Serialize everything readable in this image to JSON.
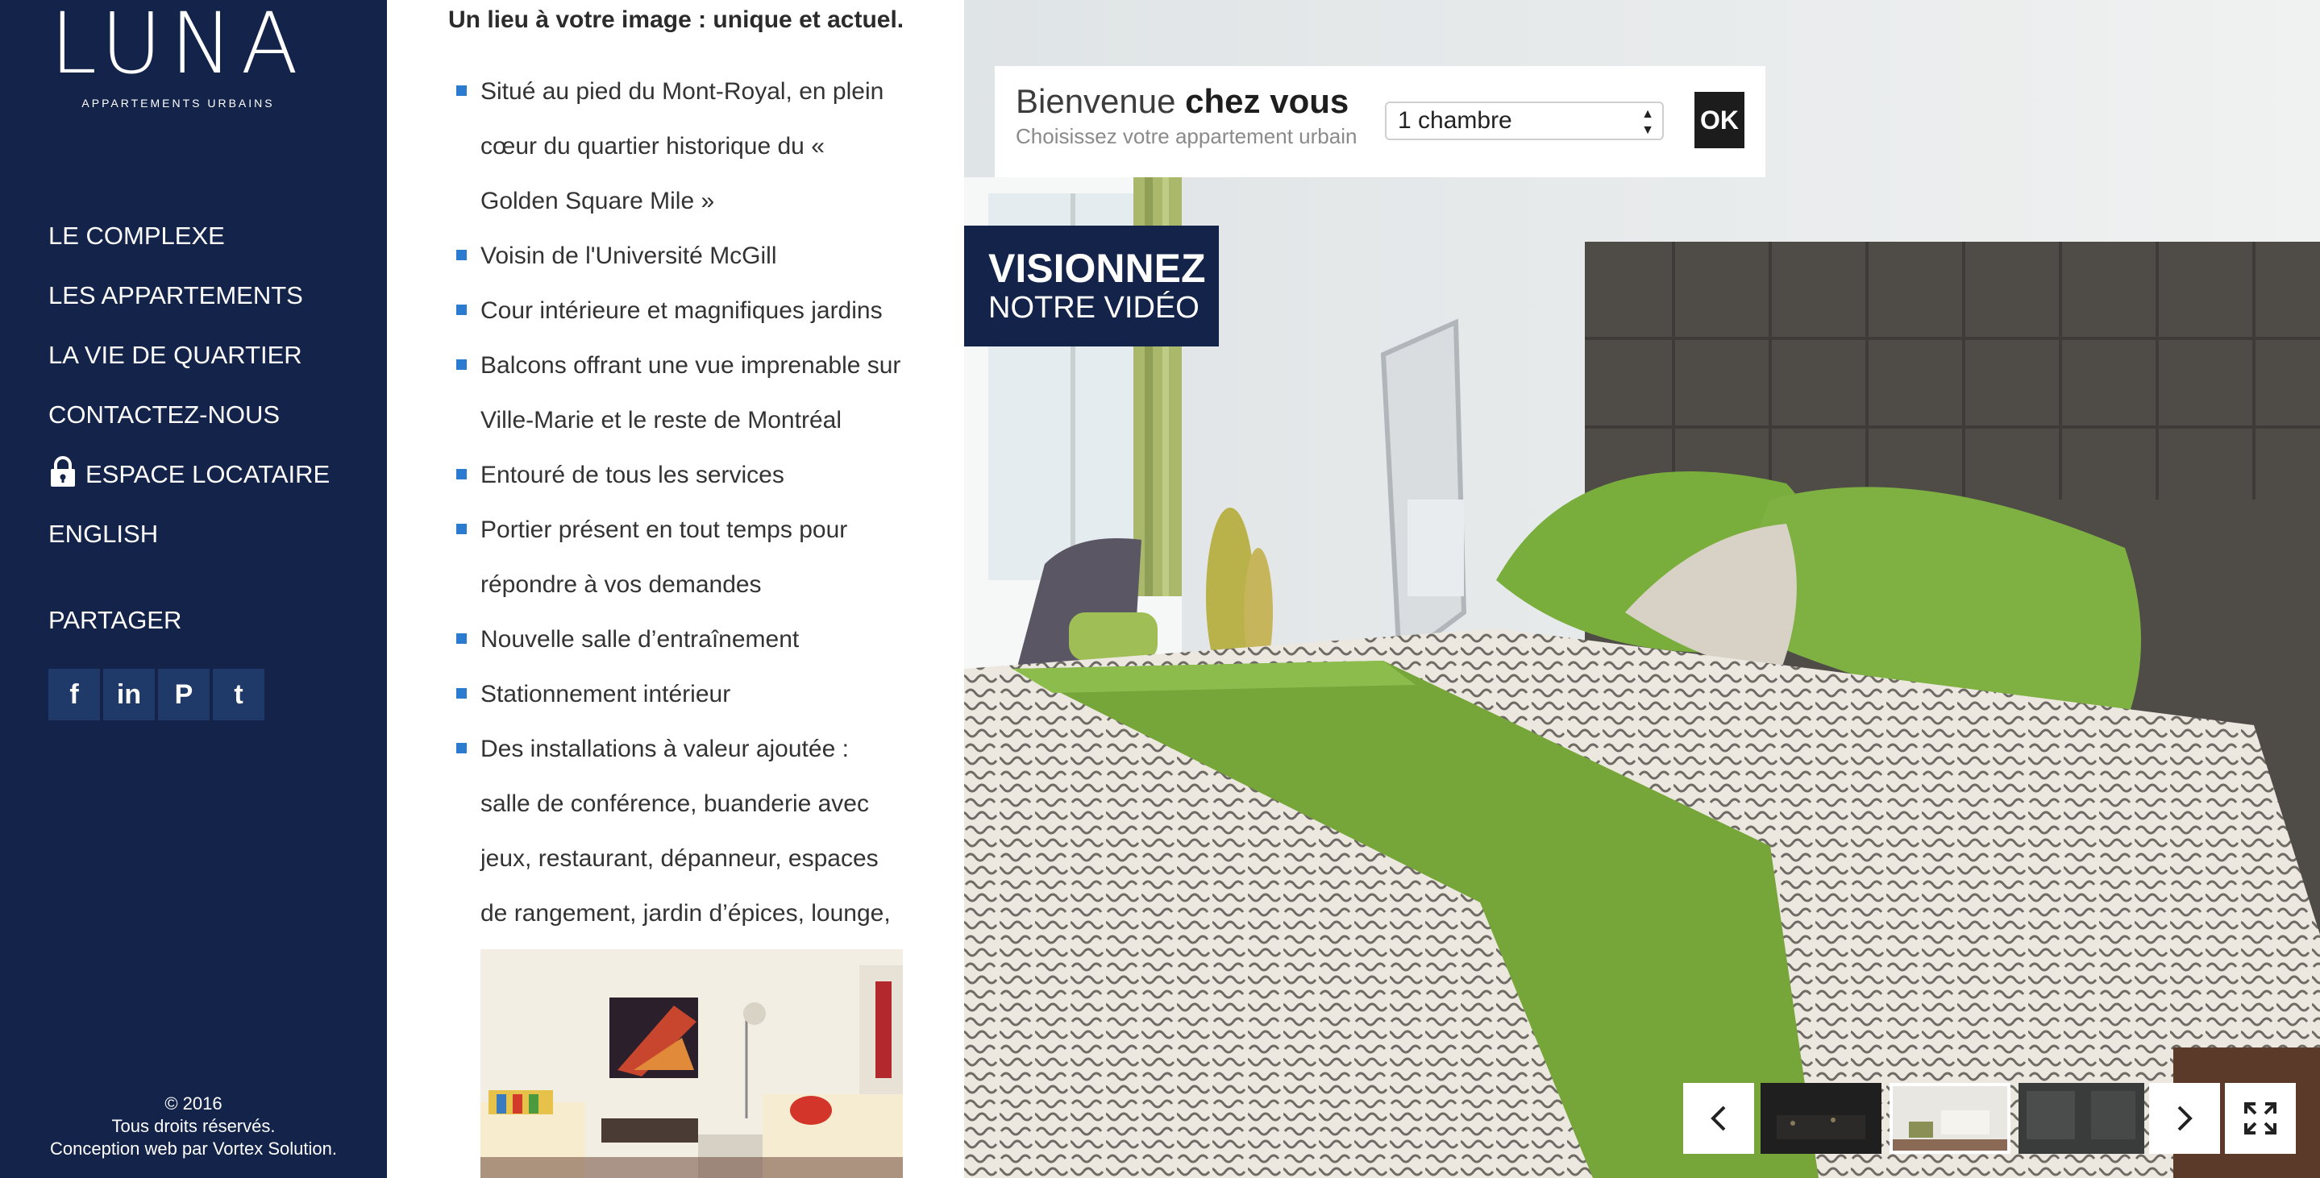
{
  "sidebar": {
    "logo": {
      "wordmark": "LUNA",
      "tagline": "APPARTEMENTS URBAINS"
    },
    "nav": [
      {
        "label": "LE COMPLEXE"
      },
      {
        "label": "LES APPARTEMENTS"
      },
      {
        "label": "LA VIE DE QUARTIER"
      },
      {
        "label": "CONTACTEZ-NOUS"
      },
      {
        "label": "ESPACE LOCATAIRE",
        "icon": "lock-icon"
      },
      {
        "label": "ENGLISH"
      }
    ],
    "share_label": "PARTAGER",
    "social": [
      {
        "name": "facebook-icon",
        "glyph": "f"
      },
      {
        "name": "linkedin-icon",
        "glyph": "in"
      },
      {
        "name": "pinterest-icon",
        "glyph": "P"
      },
      {
        "name": "twitter-icon",
        "glyph": "t"
      }
    ],
    "copyright": {
      "line1": "© 2016",
      "line2": "Tous droits réservés.",
      "line3": "Conception web par Vortex Solution."
    }
  },
  "content": {
    "intro": "Un lieu à votre image : unique et actuel.",
    "features": [
      "Situé au pied du Mont-Royal, en plein cœur du quartier historique du « Golden Square Mile »",
      "Voisin de l'Université McGill",
      "Cour intérieure et magnifiques jardins",
      "Balcons offrant une vue imprenable sur Ville-Marie et le reste de Montréal",
      "Entouré de tous les services",
      "Portier présent en tout temps pour répondre à vos demandes",
      "Nouvelle salle d’entraînement",
      "Stationnement intérieur",
      "Des installations à valeur ajoutée : salle de conférence, buanderie avec jeux, restaurant, dépanneur, espaces de rangement, jardin d’épices, lounge, etc."
    ]
  },
  "welcome": {
    "title_light": "Bienvenue ",
    "title_bold": "chez vous",
    "subtitle": "Choisissez votre appartement urbain",
    "selected_option": "1 chambre",
    "ok_label": "OK"
  },
  "video": {
    "line1": "VISIONNEZ",
    "line2": "NOTRE VIDÉO"
  },
  "colors": {
    "navy": "#13234a",
    "bullet_blue": "#2b7bd0",
    "pillow_green": "#7fb042"
  }
}
